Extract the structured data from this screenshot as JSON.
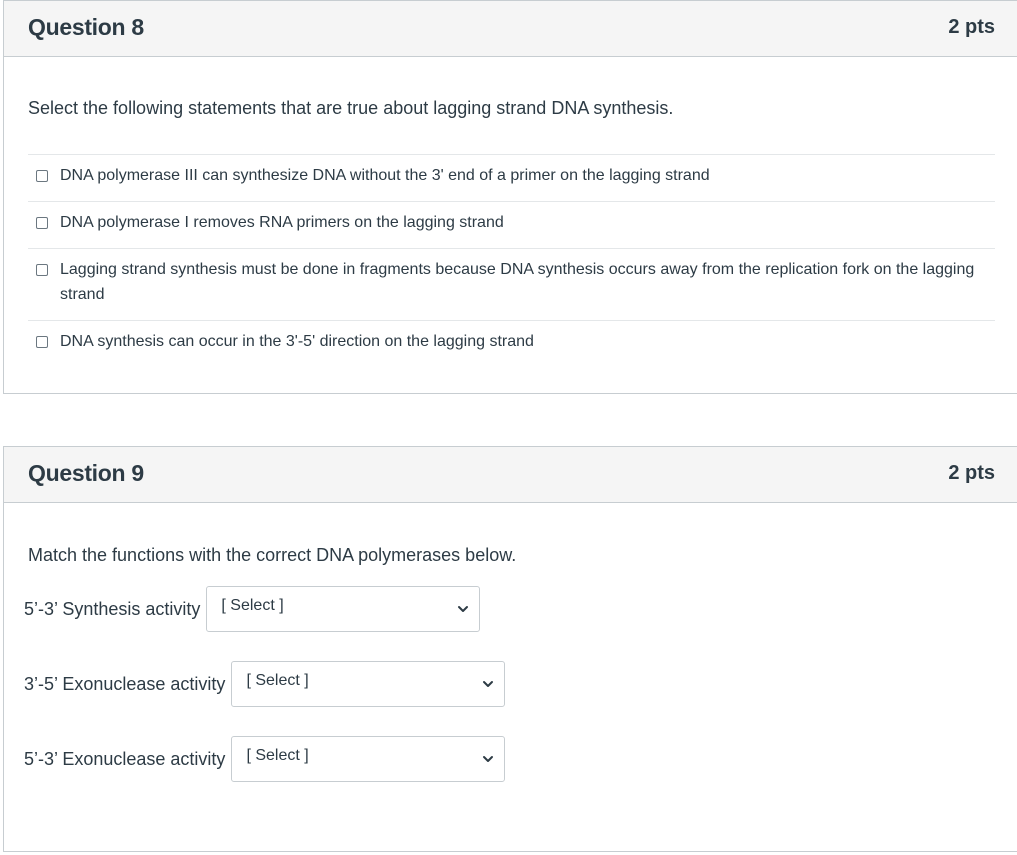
{
  "q8": {
    "title": "Question 8",
    "points": "2 pts",
    "prompt": "Select the following statements that are true about lagging strand DNA synthesis.",
    "answers": [
      {
        "label": "DNA polymerase III can synthesize DNA without the 3' end of a primer on the lagging strand",
        "checked": false
      },
      {
        "label": "DNA polymerase I removes RNA primers on the lagging strand",
        "checked": false
      },
      {
        "label": "Lagging strand synthesis must be done in fragments because DNA synthesis occurs away from the replication fork on the lagging strand",
        "checked": false
      },
      {
        "label": "DNA synthesis can occur in the 3'-5' direction on the lagging strand",
        "checked": false
      }
    ]
  },
  "q9": {
    "title": "Question 9",
    "points": "2 pts",
    "prompt": "Match the functions with the correct DNA polymerases below.",
    "rows": [
      {
        "label": "5’-3’ Synthesis activity",
        "selected": "[ Select ]"
      },
      {
        "label": "3’-5’ Exonuclease activity",
        "selected": "[ Select ]"
      },
      {
        "label": "5’-3’ Exonuclease activity",
        "selected": "[ Select ]"
      }
    ]
  },
  "icons": {
    "checkbox": "checkbox-icon",
    "dropdown": "chevron-down-icon"
  },
  "colors": {
    "text": "#2d3b45",
    "header_bg": "#f5f5f5",
    "border": "#c7cdd1"
  }
}
